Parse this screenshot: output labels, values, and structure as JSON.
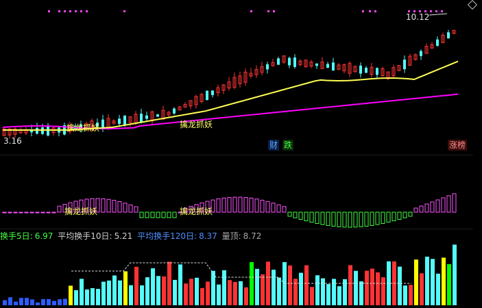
{
  "window": {
    "title": ""
  },
  "price_panel": {
    "high_label": "10.12",
    "low_label": "3.16",
    "signal_label": "擒龙抓妖",
    "signal_label_2": "擒龙抓妖",
    "badges": {
      "finance": "财",
      "fall": "跌",
      "limit_list": "涨榜"
    }
  },
  "indicator_panel": {
    "signal_label": "擒龙抓妖",
    "signal_label_2": "擒龙抓妖"
  },
  "volume_panel": {
    "turnover_5_label": "换手5日:",
    "turnover_5_value": "6.97",
    "turnover_10_label": "平均换手10日:",
    "turnover_10_value": "5.21",
    "turnover_120_label": "平均换手120日:",
    "turnover_120_value": "8.37",
    "peak_label": "量顶:",
    "peak_value": "8.72"
  },
  "colors": {
    "up": "#ff3333",
    "down": "#54fcfc",
    "ma_short": "#ffff54",
    "ma_long": "#ff00ff",
    "osc_pos": "#ff55ff",
    "osc_neg": "#44ff44",
    "vol_hi": "#ffff00",
    "vol_green": "#00ff00",
    "turnover_5": "#44ff44",
    "turnover_10": "#cccccc",
    "turnover_120": "#4488ff"
  },
  "markers": [
    "magenta-square-marker",
    "diamond-icon"
  ]
}
